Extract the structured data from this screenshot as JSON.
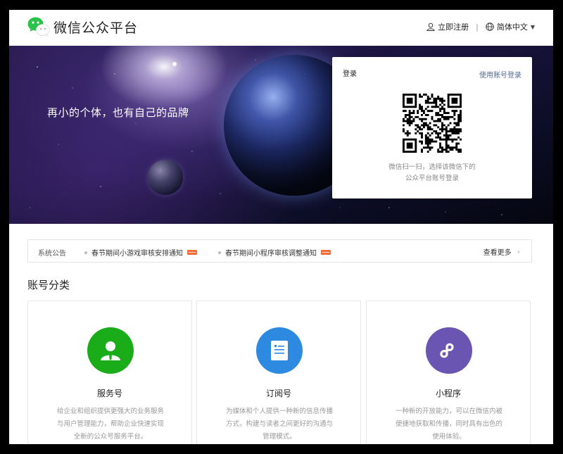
{
  "header": {
    "brand": "微信公众平台",
    "register": "立即注册",
    "separator": "|",
    "language": "简体中文"
  },
  "banner": {
    "slogan": "再小的个体，也有自己的品牌"
  },
  "login": {
    "title": "登录",
    "alt_login": "使用账号登录",
    "tip_line1": "微信扫一扫，选择该微信下的",
    "tip_line2": "公众平台账号登录"
  },
  "notice": {
    "label": "系统公告",
    "items": [
      {
        "text": "春节期间小游戏审核安排通知"
      },
      {
        "text": "春节期间小程序审核调整通知"
      }
    ],
    "more": "查看更多"
  },
  "section": {
    "title": "账号分类"
  },
  "cards": [
    {
      "name": "服务号",
      "icon": "user-icon",
      "color": "#1aad19",
      "desc_line1": "给企业和组织提供更强大的业务服务",
      "desc_line2": "与用户管理能力，帮助企业快速实现",
      "desc_line3": "全新的公众号服务平台。"
    },
    {
      "name": "订阅号",
      "icon": "document-icon",
      "color": "#2d8ae0",
      "desc_line1": "为媒体和个人提供一种新的信息传播",
      "desc_line2": "方式，构建与读者之间更好的沟通与",
      "desc_line3": "管理模式。"
    },
    {
      "name": "小程序",
      "icon": "link-icon",
      "color": "#6a55b2",
      "desc_line1": "一种新的开放能力，可以在微信内被",
      "desc_line2": "便捷地获取和传播，同时具有出色的",
      "desc_line3": "使用体验。"
    }
  ],
  "colors": {
    "link": "#576b95",
    "new_badge": "#f36c37"
  }
}
